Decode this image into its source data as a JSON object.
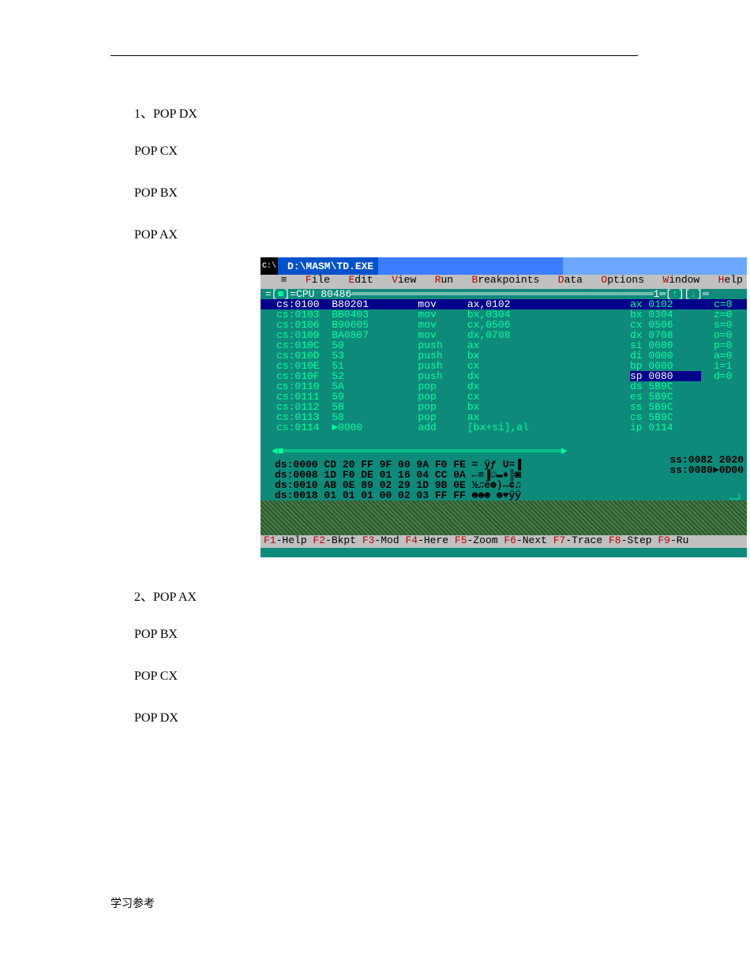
{
  "text": {
    "q1": "1、POP DX",
    "p_cx": "POP CX",
    "p_bx": "POP BX",
    "p_ax": "POP AX",
    "q2": "2、POP AX",
    "p_bx2": "POP BX",
    "p_cx2": "POP CX",
    "p_dx2": "POP DX",
    "footer": "学习参考"
  },
  "window": {
    "title": "D:\\MASM\\TD.EXE",
    "menu": [
      {
        "hot": "F",
        "rest": "ile"
      },
      {
        "hot": "E",
        "rest": "dit"
      },
      {
        "hot": "V",
        "rest": "iew"
      },
      {
        "hot": "R",
        "rest": "un"
      },
      {
        "hot": "B",
        "rest": "reakpoints"
      },
      {
        "hot": "D",
        "rest": "ata"
      },
      {
        "hot": "O",
        "rest": "ptions"
      },
      {
        "hot": "W",
        "rest": "indow"
      },
      {
        "hot": "H",
        "rest": "elp"
      }
    ],
    "panel_label": "CPU 80486",
    "code": [
      {
        "addr": "cs:0100",
        "bytes": "B80201",
        "mn": "mov",
        "op": "ax,0102",
        "hl": true
      },
      {
        "addr": "cs:0103",
        "bytes": "BB0403",
        "mn": "mov",
        "op": "bx,0304"
      },
      {
        "addr": "cs:0106",
        "bytes": "B90605",
        "mn": "mov",
        "op": "cx,0506"
      },
      {
        "addr": "cs:0109",
        "bytes": "BA0807",
        "mn": "mov",
        "op": "dx,0708"
      },
      {
        "addr": "cs:010C",
        "bytes": "50",
        "mn": "push",
        "op": "ax"
      },
      {
        "addr": "cs:010D",
        "bytes": "53",
        "mn": "push",
        "op": "bx"
      },
      {
        "addr": "cs:010E",
        "bytes": "51",
        "mn": "push",
        "op": "cx"
      },
      {
        "addr": "cs:010F",
        "bytes": "52",
        "mn": "push",
        "op": "dx"
      },
      {
        "addr": "cs:0110",
        "bytes": "5A",
        "mn": "pop",
        "op": "dx"
      },
      {
        "addr": "cs:0111",
        "bytes": "59",
        "mn": "pop",
        "op": "cx"
      },
      {
        "addr": "cs:0112",
        "bytes": "5B",
        "mn": "pop",
        "op": "bx"
      },
      {
        "addr": "cs:0113",
        "bytes": "58",
        "mn": "pop",
        "op": "ax"
      },
      {
        "addr": "cs:0114",
        "bytes": "►0000",
        "mn": "add",
        "op": "[bx+si],al"
      }
    ],
    "regs": [
      {
        "n": "ax",
        "v": "0102"
      },
      {
        "n": "bx",
        "v": "0304"
      },
      {
        "n": "cx",
        "v": "0506"
      },
      {
        "n": "dx",
        "v": "0708"
      },
      {
        "n": "si",
        "v": "0000"
      },
      {
        "n": "di",
        "v": "0000"
      },
      {
        "n": "bp",
        "v": "0000"
      },
      {
        "n": "sp",
        "v": "0080",
        "hl": true
      },
      {
        "n": "ds",
        "v": "5B9C"
      },
      {
        "n": "es",
        "v": "5B9C"
      },
      {
        "n": "ss",
        "v": "5B9C"
      },
      {
        "n": "cs",
        "v": "5B9C"
      },
      {
        "n": "ip",
        "v": "0114"
      }
    ],
    "flags": [
      "c=0",
      "z=0",
      "s=0",
      "o=0",
      "p=0",
      "a=0",
      "i=1",
      "d=0"
    ],
    "dump": [
      "ds:0000 CD 20 FF 9F 00 9A F0 FE = ÿƒ U=▐",
      "ds:0008 1D F0 DE 01 16 04 CC 0A ←≡▐☺▬♦╠◙",
      "ds:0010 AB 0E 89 02 29 1D 9B 0E ½♫ë☻)↔¢♫",
      "ds:0018 01 01 01 00 02 03 FF FF ☻☻☻ ☻♥ÿÿ"
    ],
    "stack": [
      "ss:0082 2020",
      "ss:0080►0D00"
    ],
    "fkeys": [
      {
        "f": "F1",
        "t": "-Help "
      },
      {
        "f": "F2",
        "t": "-Bkpt "
      },
      {
        "f": "F3",
        "t": "-Mod "
      },
      {
        "f": "F4",
        "t": "-Here "
      },
      {
        "f": "F5",
        "t": "-Zoom "
      },
      {
        "f": "F6",
        "t": "-Next "
      },
      {
        "f": "F7",
        "t": "-Trace "
      },
      {
        "f": "F8",
        "t": "-Step "
      },
      {
        "f": "F9",
        "t": "-Ru"
      }
    ]
  }
}
